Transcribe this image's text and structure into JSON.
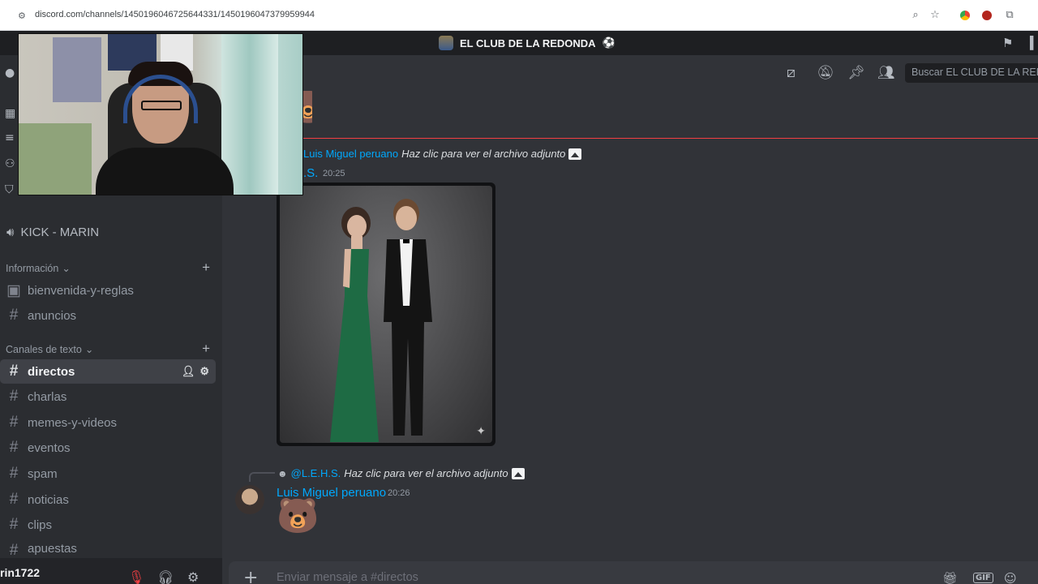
{
  "browser": {
    "url": "discord.com/channels/1450196046725644331/1450196047379959944",
    "icons": [
      "tune-icon",
      "zoom-icon",
      "star-icon",
      "extension-icon"
    ],
    "accent": "#1a73e8"
  },
  "server": {
    "name": "EL CLUB DE LA REDONDA",
    "badge": "⚽"
  },
  "header": {
    "search_placeholder": "Buscar EL CLUB DE LA RED"
  },
  "sidebar": {
    "voice_channel": "KICK - MARIN",
    "categories": [
      {
        "label": "Información",
        "channels": [
          "bienvenida-y-reglas",
          "anuncios"
        ]
      },
      {
        "label": "Canales de texto",
        "channels": [
          "directos",
          "charlas",
          "memes-y-videos",
          "eventos",
          "spam",
          "noticias",
          "clips",
          "apuestas"
        ]
      }
    ],
    "active_channel": "directos"
  },
  "user_panel": {
    "username": "rin1722"
  },
  "messages": [
    {
      "reply_mention": "Luis Miguel peruano",
      "reply_text": "Haz clic para ver el archivo adjunto",
      "author": "L.E.H.S.",
      "author_visible": ".S.",
      "time": "20:25",
      "attachment": "image"
    },
    {
      "reply_mention": "@L.E.H.S.",
      "reply_text": "Haz clic para ver el archivo adjunto",
      "author": "Luis Miguel peruano",
      "time": "20:26",
      "content": "🐻"
    }
  ],
  "top_sticker": "🐻",
  "composer": {
    "placeholder": "Enviar mensaje a #directos",
    "gif_label": "GIF"
  },
  "colors": {
    "mention": "#00a8fc",
    "new_divider": "#f23f43",
    "background": "#313338",
    "sidebar": "#2b2d31"
  }
}
